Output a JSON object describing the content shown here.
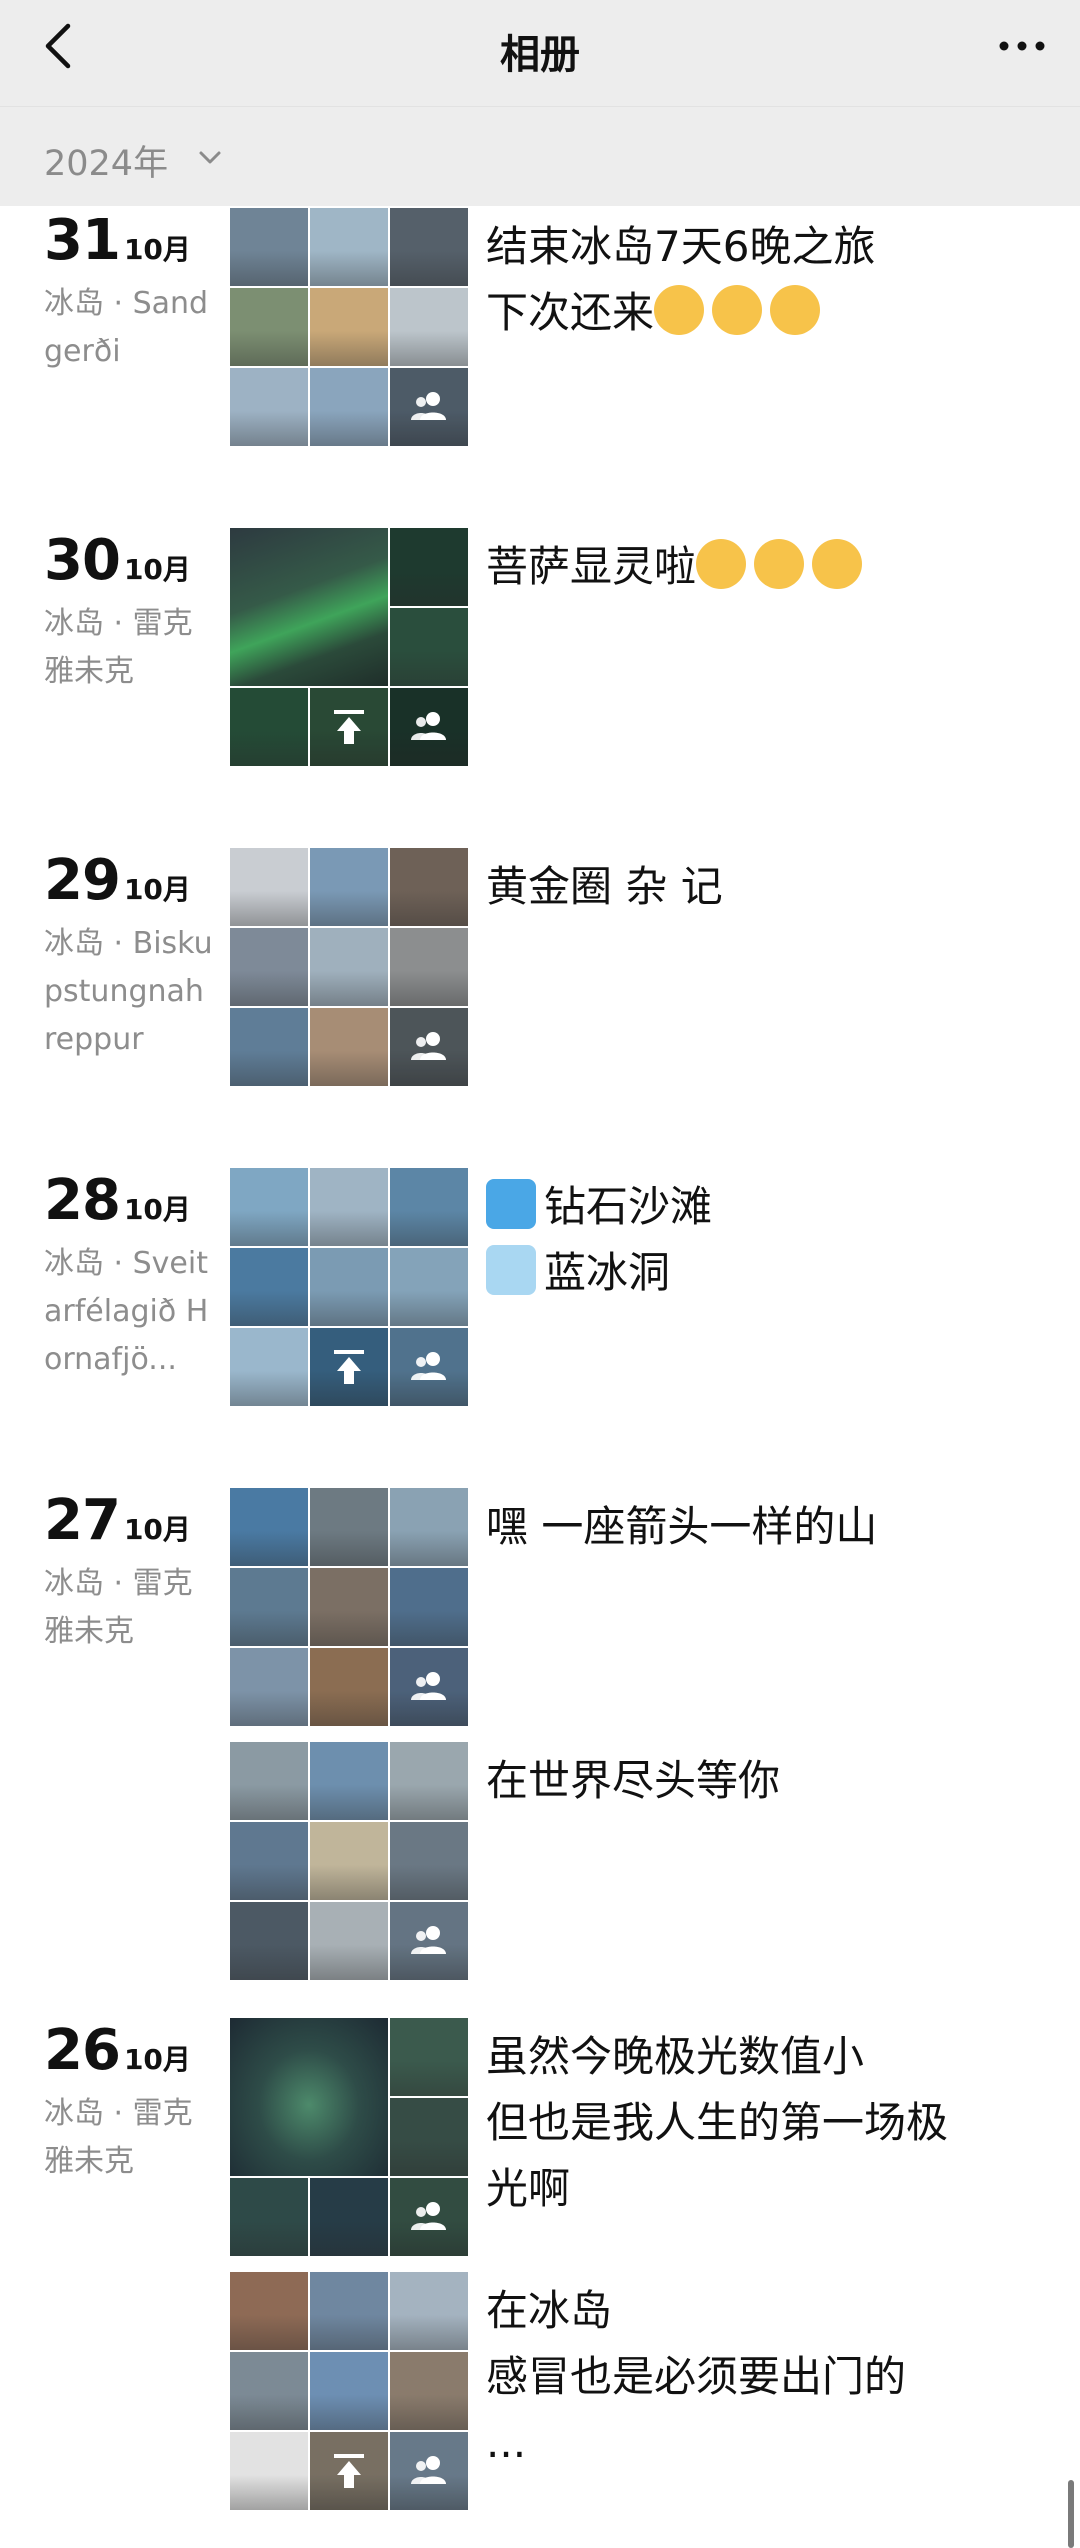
{
  "nav": {
    "title": "相册",
    "back_icon": "chevron-left-icon",
    "more_icon": "more-horizontal-icon"
  },
  "year_filter": {
    "label": "2024年",
    "icon": "chevron-down-icon"
  },
  "colors": {
    "nav_bg": "#ededed",
    "secondary_text": "#8d8d8d"
  },
  "entries": [
    {
      "day": "31",
      "month": "10月",
      "location": "冰岛 · Sandgerði",
      "posts": [
        {
          "lines": [
            "结束冰岛7天6晚之旅",
            "下次还来😊😊😊"
          ],
          "overlay": "group",
          "photos": [
            "#6f8496",
            "#9fb6c6",
            "#55606a",
            "#7c8f72",
            "#c9a878",
            "#bcc5cb",
            "#9db2c4",
            "#8aa5bd",
            "#5b6b7a"
          ]
        }
      ]
    },
    {
      "day": "30",
      "month": "10月",
      "location": "冰岛 · 雷克雅未克",
      "posts": [
        {
          "lines": [
            "菩萨显灵啦😇😇😇"
          ],
          "overlay": "aurora",
          "photos": [
            "#2f6a4a",
            "#1e3a2f",
            "#2a4e3d",
            "#244b36",
            "#31563f"
          ]
        }
      ]
    },
    {
      "day": "29",
      "month": "10月",
      "location": "冰岛 · Biskupstungnahreppur",
      "posts": [
        {
          "lines": [
            "黄金圈 杂 记"
          ],
          "overlay": "group",
          "photos": [
            "#c9cdd2",
            "#7a99b5",
            "#6e6157",
            "#7e8a98",
            "#9fb0bd",
            "#8c8e8f",
            "#5f7d97",
            "#a78d75",
            "#5b6469"
          ]
        }
      ]
    },
    {
      "day": "28",
      "month": "10月",
      "location": "冰岛 · Sveitarfélagið Hornafjö...",
      "posts": [
        {
          "lines": [
            "💎钻石沙滩",
            "🧊蓝冰洞"
          ],
          "overlay": "upload-group",
          "photos": [
            "#7fa7c3",
            "#9fb4c4",
            "#5c86a6",
            "#4b7aa0",
            "#7b9bb3",
            "#84a3b9",
            "#9ab7cc",
            "#3f6f93",
            "#5f87a6"
          ]
        }
      ]
    },
    {
      "day": "27",
      "month": "10月",
      "location": "冰岛 · 雷克雅未克",
      "posts": [
        {
          "lines": [
            "嘿 一座箭头一样的山"
          ],
          "overlay": "group",
          "photos": [
            "#4a7aa3",
            "#6d7a82",
            "#8aa2b3",
            "#5d7a91",
            "#7b6f64",
            "#4f6e8c",
            "#7d93a8",
            "#8b6d52",
            "#5a7390"
          ]
        },
        {
          "lines": [
            "在世界尽头等你"
          ],
          "overlay": "group",
          "photos": [
            "#8b9aa3",
            "#6d8fae",
            "#9aa7ae",
            "#5f7890",
            "#c0b59a",
            "#6a7884",
            "#4c5964",
            "#a8b0b5",
            "#76899a"
          ]
        }
      ]
    },
    {
      "day": "26",
      "month": "10月",
      "location": "冰岛 · 雷克雅未克",
      "posts": [
        {
          "lines": [
            "虽然今晚极光数值小",
            "但也是我人生的第一场极",
            "光啊"
          ],
          "overlay": "aurora2",
          "photos": [
            "#2b3a44",
            "#3b5a4d",
            "#364c45",
            "#2e4a48",
            "#263c47"
          ]
        },
        {
          "lines": [
            "在冰岛",
            "感冒也是必须要出门的",
            "..."
          ],
          "overlay": "upload-group",
          "photos": [
            "#8e6a55",
            "#6f87a0",
            "#a4b3c0",
            "#7c8a95",
            "#6d8fb3",
            "#8a7b6c",
            "#e2e2e2",
            "#8d8374",
            "#7a8fa2"
          ]
        }
      ]
    }
  ]
}
